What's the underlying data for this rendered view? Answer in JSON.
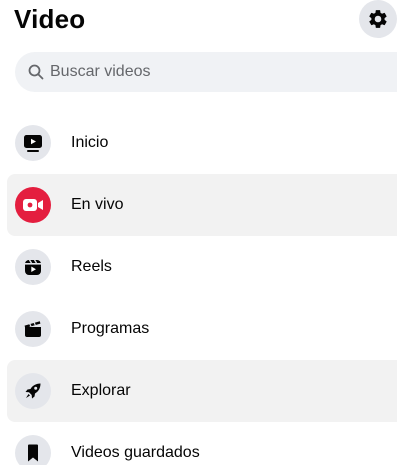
{
  "header": {
    "title": "Video",
    "settings_icon": "gear-icon"
  },
  "search": {
    "placeholder": "Buscar videos",
    "value": ""
  },
  "nav": {
    "items": [
      {
        "label": "Inicio",
        "icon": "play-screen-icon",
        "active": false
      },
      {
        "label": "En vivo",
        "icon": "live-camera-icon",
        "active": true
      },
      {
        "label": "Reels",
        "icon": "reels-icon",
        "active": false
      },
      {
        "label": "Programas",
        "icon": "clapperboard-icon",
        "active": false
      },
      {
        "label": "Explorar",
        "icon": "rocket-icon",
        "active": true
      },
      {
        "label": "Videos guardados",
        "icon": "bookmark-icon",
        "active": false
      }
    ]
  },
  "colors": {
    "live_accent": "#e41e3f",
    "icon_bg": "#e4e6eb",
    "search_bg": "#f0f2f5",
    "active_row_bg": "#f2f2f2"
  }
}
